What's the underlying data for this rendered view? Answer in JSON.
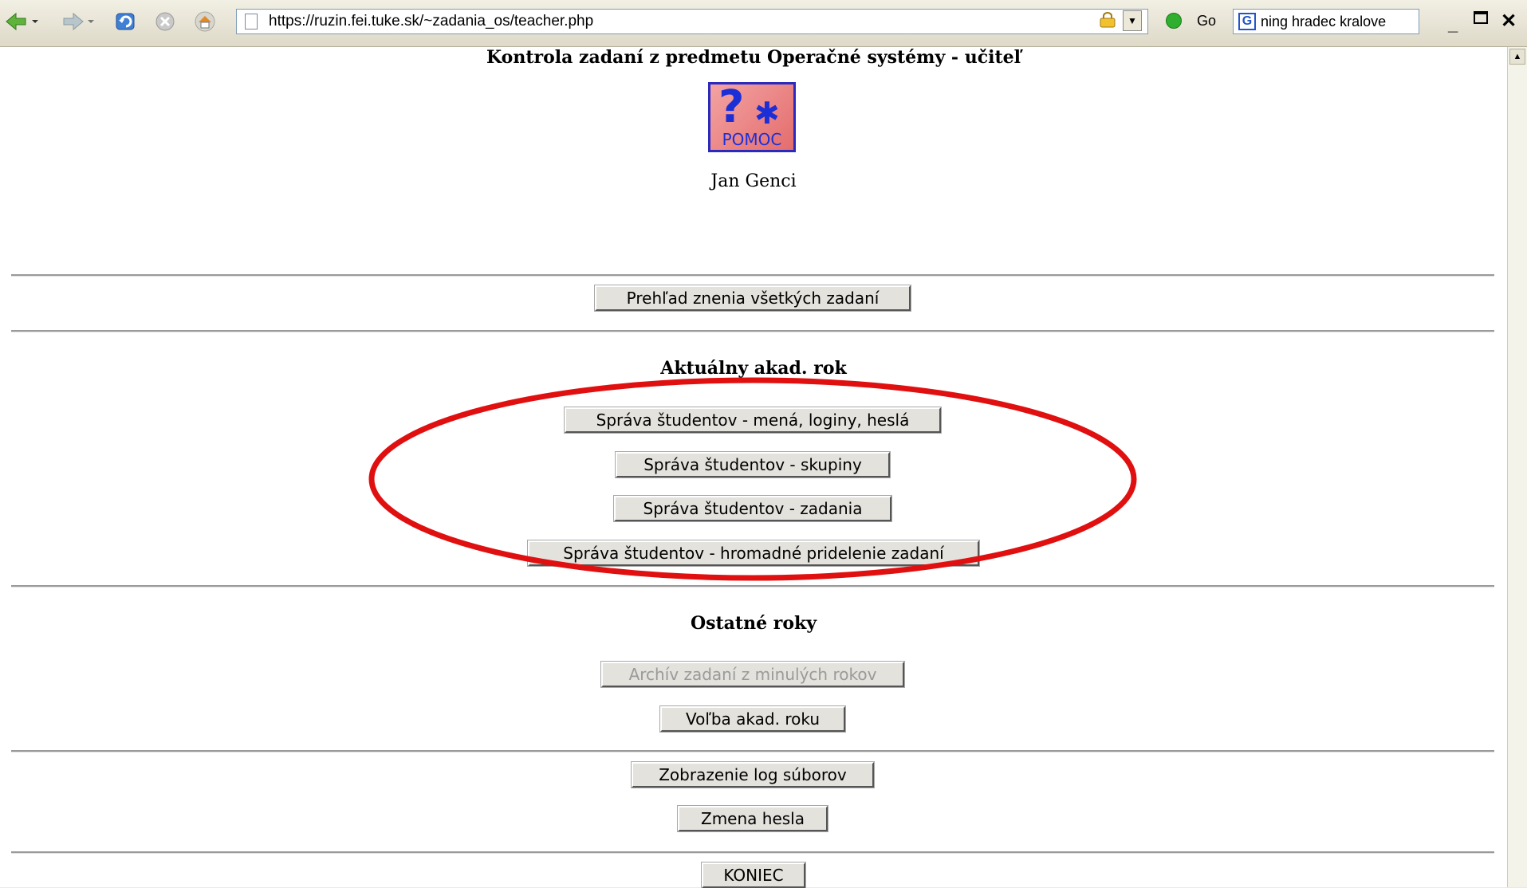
{
  "browser": {
    "url": "https://ruzin.fei.tuke.sk/~zadania_os/teacher.php",
    "go_label": "Go",
    "search_query": "ning hradec kralove",
    "icons": [
      "back-icon",
      "forward-icon",
      "refresh-icon",
      "stop-icon",
      "home-icon",
      "lock-icon",
      "go-icon",
      "google-icon"
    ]
  },
  "page": {
    "title": "Kontrola zadaní z predmetu Operačné systémy - učiteľ",
    "help_label": "POMOC",
    "user_name": "Jan Genci",
    "overview_button": "Prehľad znenia všetkých zadaní",
    "current_year_heading": "Aktuálny akad. rok",
    "current_year_buttons": [
      "Správa študentov - mená, loginy, heslá",
      "Správa študentov - skupiny",
      "Správa študentov - zadania",
      "Správa študentov - hromadné pridelenie zadaní"
    ],
    "other_years_heading": "Ostatné roky",
    "archive_button": "Archív zadaní z minulých rokov",
    "year_choice_button": "Voľba akad. roku",
    "logs_button": "Zobrazenie log súborov",
    "password_button": "Zmena hesla",
    "exit_button": "KONIEC"
  },
  "colors": {
    "frame": "#f6efa8",
    "annotation": "#e01010",
    "help_text": "#1c2fd6"
  }
}
